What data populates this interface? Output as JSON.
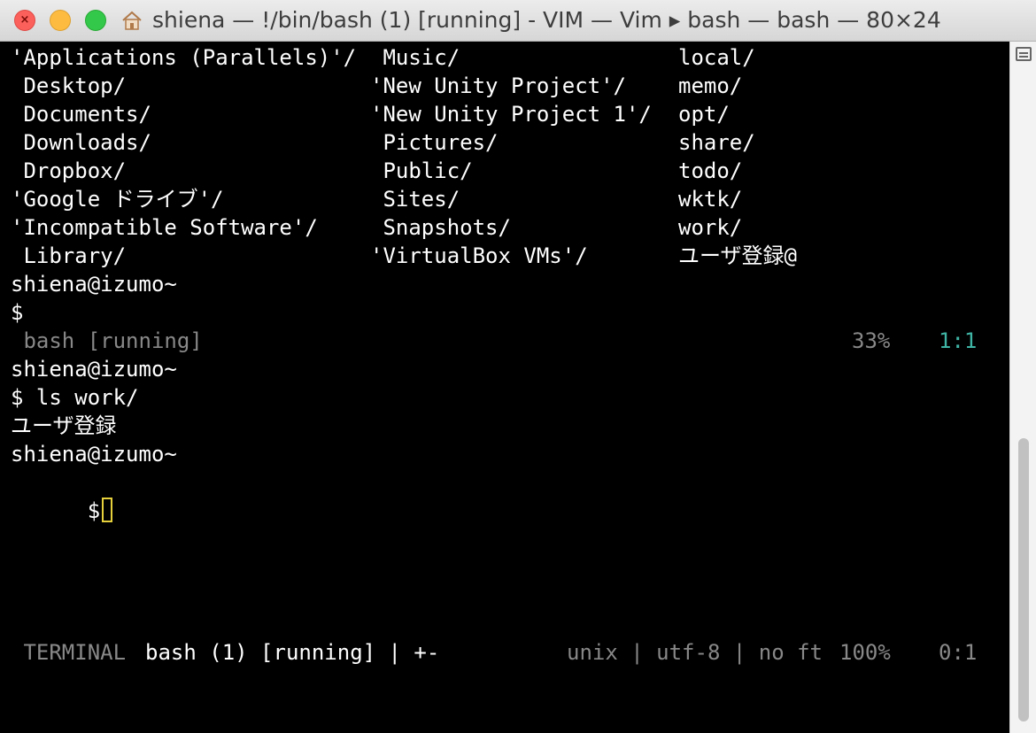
{
  "window": {
    "title": "shiena — !/bin/bash (1) [running] - VIM — Vim ▸ bash — bash — 80×24",
    "close_glyph": "×",
    "colors": {
      "close": "#fc605b",
      "minimize": "#fdbc40",
      "maximize": "#34c84a"
    }
  },
  "terminal": {
    "listing": [
      [
        "'Applications (Parallels)'/",
        " Music/",
        "local/"
      ],
      [
        " Desktop/",
        "'New Unity Project'/",
        "memo/"
      ],
      [
        " Documents/",
        "'New Unity Project 1'/",
        "opt/"
      ],
      [
        " Downloads/",
        " Pictures/",
        "share/"
      ],
      [
        " Dropbox/",
        " Public/",
        "todo/"
      ],
      [
        "'Google ドライブ'/",
        " Sites/",
        "wktk/"
      ],
      [
        "'Incompatible Software'/",
        " Snapshots/",
        "work/"
      ],
      [
        " Library/",
        "'VirtualBox VMs'/",
        "ユーザ登録@"
      ]
    ],
    "prompt1_host": "shiena@izumo~",
    "prompt1_sign": "$",
    "status_top": {
      "name": " bash [running]",
      "percent": "33%",
      "position": "1:1"
    },
    "prompt2_host": "shiena@izumo~",
    "prompt2_cmd": "$ ls work/",
    "output": "ユーザ登録",
    "prompt3_host": "shiena@izumo~",
    "prompt3_sign": "$",
    "status_bottom": {
      "mode": " TERMINAL",
      "name": "bash (1) [running] | +-",
      "info": "unix | utf-8 | no ft",
      "percent": "100%",
      "position": "0:1"
    }
  },
  "colors": {
    "status_gray": "#888888",
    "position_teal": "#3fb5a6",
    "cursor": "#e6d13c"
  }
}
